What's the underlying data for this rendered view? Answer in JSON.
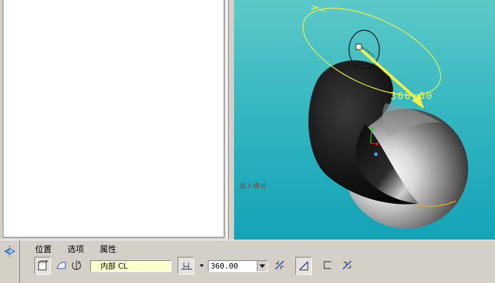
{
  "dashboard": {
    "tabs": [
      {
        "label": "位置"
      },
      {
        "label": "选项"
      },
      {
        "label": "属性"
      }
    ],
    "reference": {
      "value": "内部 CL"
    },
    "angle": {
      "value": "360.00"
    }
  },
  "viewport": {
    "mode_text": "插入模式",
    "angle_label": "360.00"
  },
  "colors": {
    "background_top": "#5cc9c9",
    "background_bottom": "#13a3b8",
    "preview_curve": "#f2f24a"
  }
}
